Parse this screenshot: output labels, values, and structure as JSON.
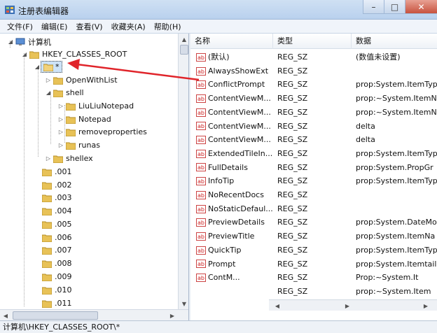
{
  "window": {
    "title": "注册表编辑器"
  },
  "menu": [
    "文件(F)",
    "编辑(E)",
    "查看(V)",
    "收藏夹(A)",
    "帮助(H)"
  ],
  "tree": {
    "computer": "计算机",
    "root_key": "HKEY_CLASSES_ROOT",
    "selected_key": "*",
    "children": [
      "OpenWithList",
      "shell",
      "LiuLiuNotepad",
      "Notepad",
      "removeproperties",
      "runas",
      "shellex"
    ],
    "extensions": [
      ".001",
      ".002",
      ".003",
      ".004",
      ".005",
      ".006",
      ".007",
      ".008",
      ".009",
      ".010",
      ".011"
    ]
  },
  "list": {
    "columns": [
      "名称",
      "类型",
      "数据"
    ],
    "rows": [
      {
        "name": "(默认)",
        "type": "REG_SZ",
        "data": "(数值未设置)"
      },
      {
        "name": "AlwaysShowExt",
        "type": "REG_SZ",
        "data": ""
      },
      {
        "name": "ConflictPrompt",
        "type": "REG_SZ",
        "data": "prop:System.ItemTyp"
      },
      {
        "name": "ContentViewM...",
        "type": "REG_SZ",
        "data": "prop:~System.ItemN"
      },
      {
        "name": "ContentViewM...",
        "type": "REG_SZ",
        "data": "prop:~System.ItemN"
      },
      {
        "name": "ContentViewM...",
        "type": "REG_SZ",
        "data": "delta"
      },
      {
        "name": "ContentViewM...",
        "type": "REG_SZ",
        "data": "delta"
      },
      {
        "name": "ExtendedTileIn...",
        "type": "REG_SZ",
        "data": "prop:System.ItemTyp"
      },
      {
        "name": "FullDetails",
        "type": "REG_SZ",
        "data": "prop:System.PropGr"
      },
      {
        "name": "InfoTip",
        "type": "REG_SZ",
        "data": "prop:System.ItemTyp"
      },
      {
        "name": "NoRecentDocs",
        "type": "REG_SZ",
        "data": ""
      },
      {
        "name": "NoStaticDefaul...",
        "type": "REG_SZ",
        "data": ""
      },
      {
        "name": "PreviewDetails",
        "type": "REG_SZ",
        "data": "prop:System.DateMo"
      },
      {
        "name": "PreviewTitle",
        "type": "REG_SZ",
        "data": "prop:System.ItemNa"
      },
      {
        "name": "QuickTip",
        "type": "REG_SZ",
        "data": "prop:System.ItemTyp"
      },
      {
        "name": "Prompt",
        "type": "REG_SZ",
        "data": "prop:System.Itemtail"
      },
      {
        "name": "ContM...",
        "type": "REG_SZ",
        "data": "Prop:~System.It"
      },
      {
        "name": "",
        "type": "REG_SZ",
        "data": "prop:~System.Item"
      }
    ]
  },
  "statusbar": {
    "path": "计算机\\HKEY_CLASSES_ROOT\\*"
  },
  "colors": {
    "arrow": "#e0242a",
    "folder": "#e8c257",
    "selection": "#cde3f8"
  }
}
